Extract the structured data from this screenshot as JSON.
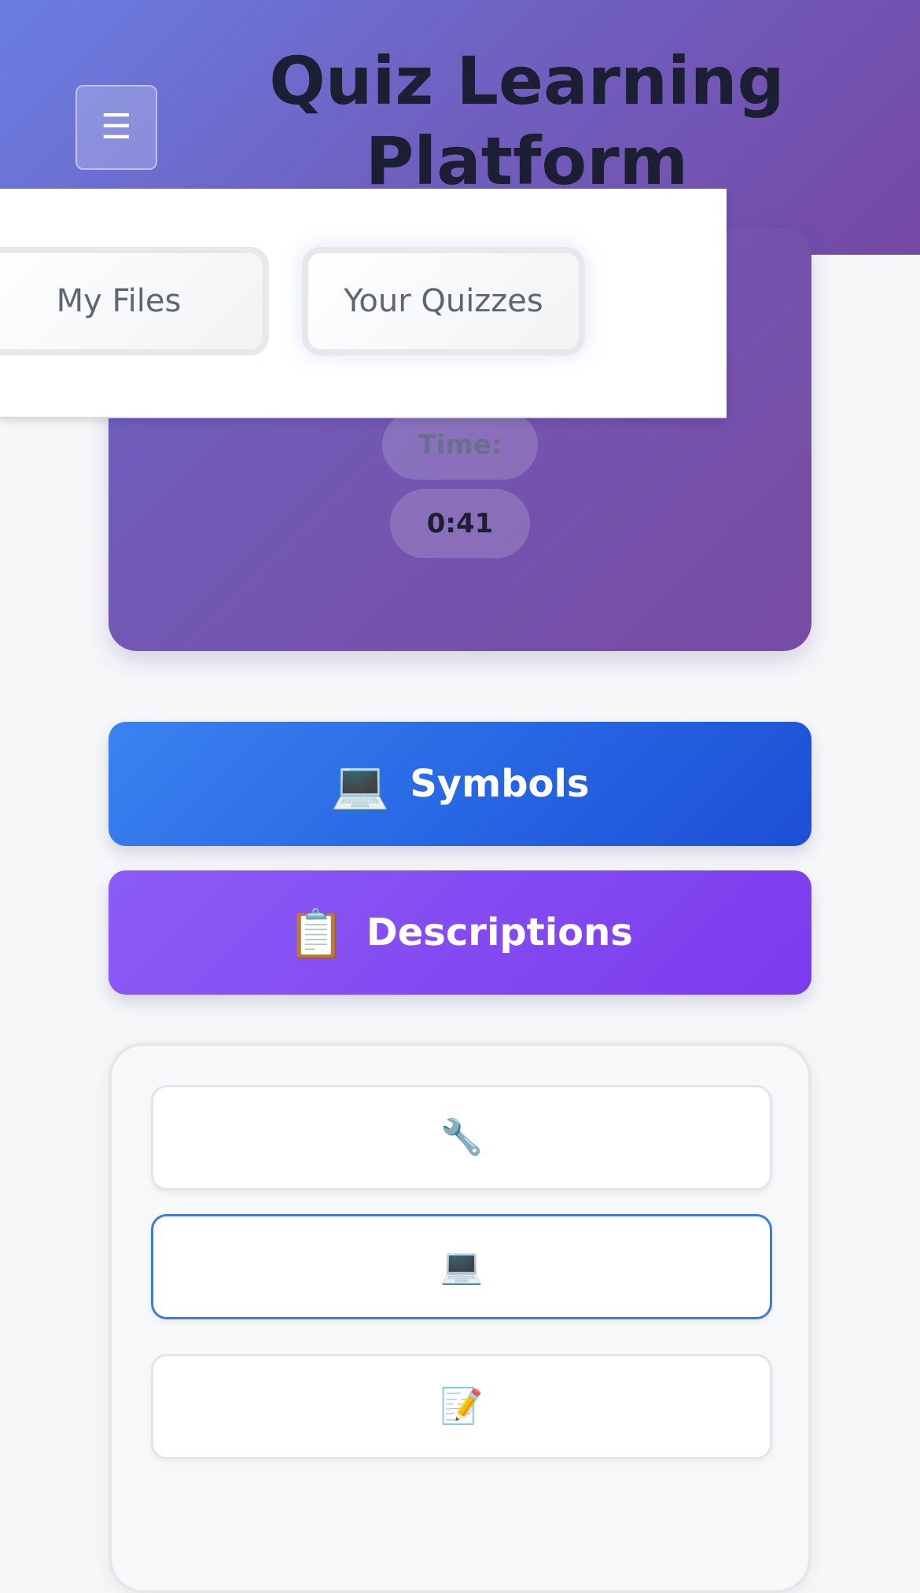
{
  "header": {
    "title": "Quiz Learning Platform",
    "menu_icon": "☰"
  },
  "nav": {
    "items": [
      {
        "label": "My Files"
      },
      {
        "label": "Your Quizzes"
      }
    ]
  },
  "timer": {
    "label": "Time:",
    "value": "0:41"
  },
  "categories": [
    {
      "icon": "💻",
      "label": "Symbols",
      "color": "#2563eb"
    },
    {
      "icon": "📋",
      "label": "Descriptions",
      "color": "#7c3aed"
    }
  ],
  "answers": {
    "options": [
      {
        "icon": "🔧",
        "selected": false
      },
      {
        "icon": "💻",
        "selected": true
      },
      {
        "icon": "📝",
        "selected": false
      }
    ],
    "selected_border_color": "#3b7be6"
  }
}
